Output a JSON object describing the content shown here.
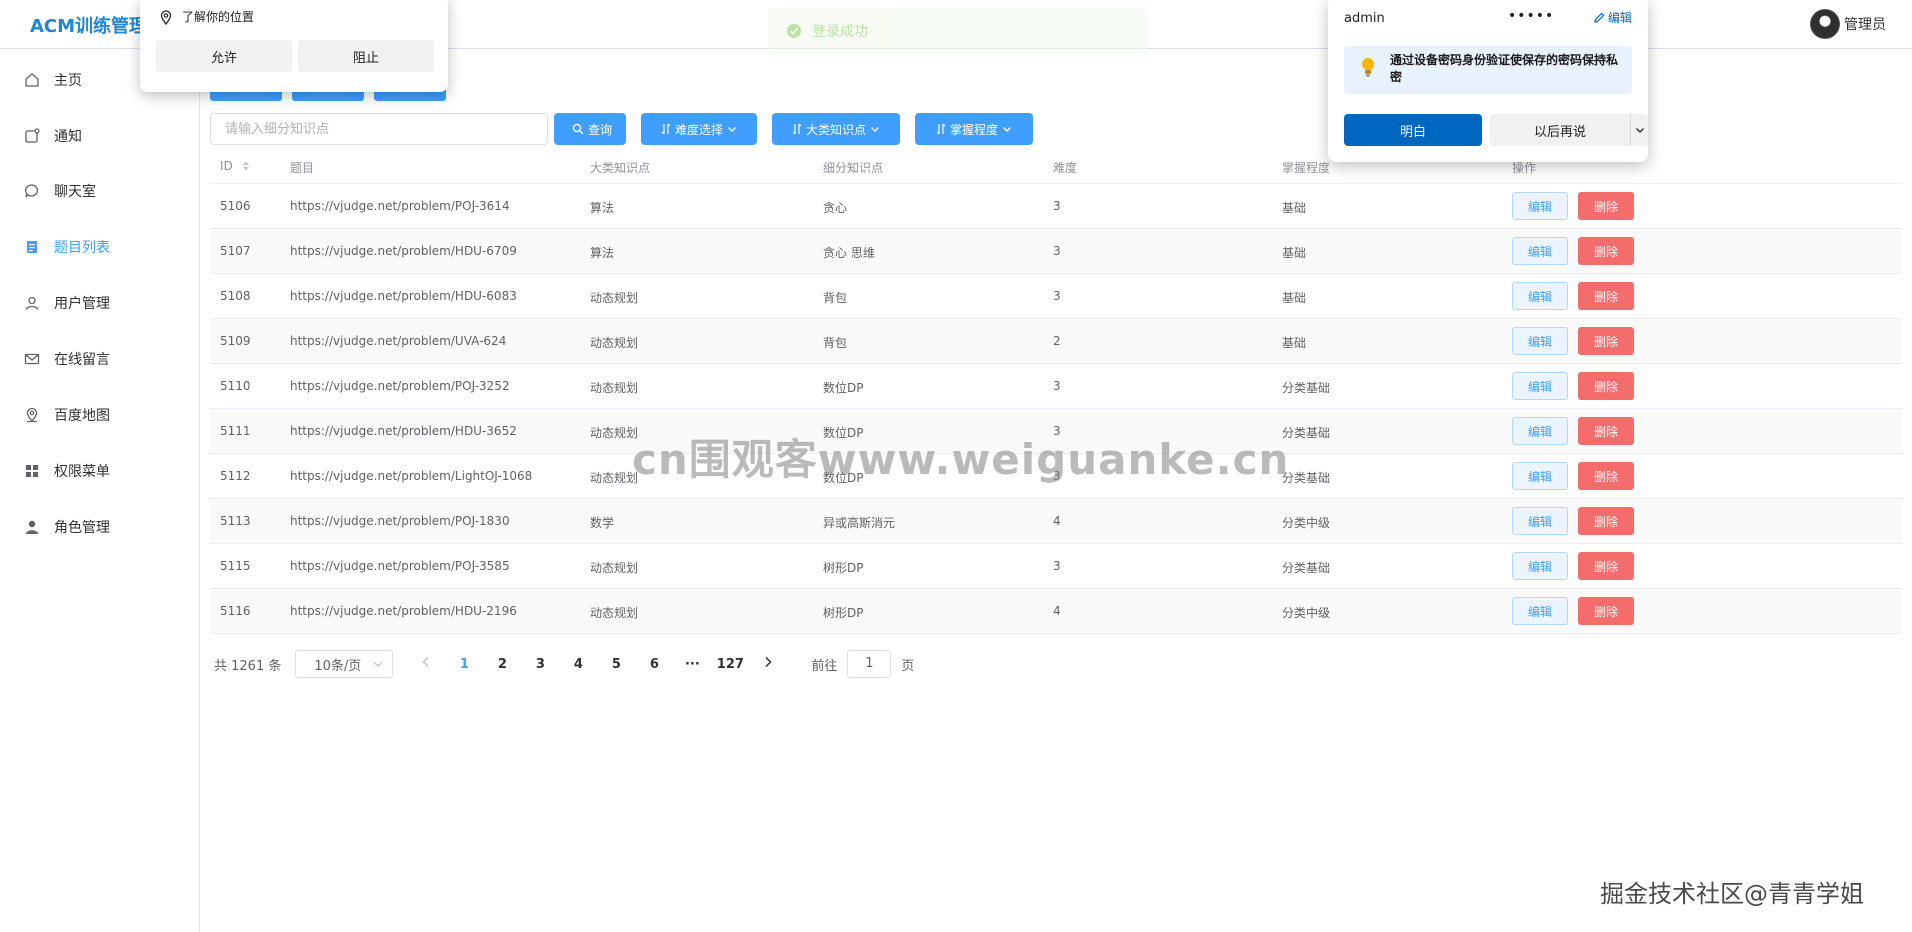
{
  "header": {
    "brand": "ACM训练管理系",
    "user_name": "管理员"
  },
  "sidebar": {
    "items": [
      {
        "label": "主页",
        "icon": "home-icon"
      },
      {
        "label": "通知",
        "icon": "notification-icon"
      },
      {
        "label": "聊天室",
        "icon": "chat-icon"
      },
      {
        "label": "题目列表",
        "icon": "document-icon",
        "active": true
      },
      {
        "label": "用户管理",
        "icon": "user-icon"
      },
      {
        "label": "在线留言",
        "icon": "mail-icon"
      },
      {
        "label": "百度地图",
        "icon": "location-icon"
      },
      {
        "label": "权限菜单",
        "icon": "grid-icon"
      },
      {
        "label": "角色管理",
        "icon": "person-icon"
      }
    ]
  },
  "toolbar": {
    "search_placeholder": "请输入细分知识点",
    "query_label": "查询",
    "difficulty_label": "难度选择",
    "category_label": "大类知识点",
    "mastery_label": "掌握程度"
  },
  "table": {
    "columns": {
      "id": "ID",
      "title": "题目",
      "category": "大类知识点",
      "subcategory": "细分知识点",
      "difficulty": "难度",
      "mastery": "掌握程度",
      "actions": "操作"
    },
    "edit_label": "编辑",
    "delete_label": "删除",
    "rows": [
      {
        "id": "5106",
        "title": "https://vjudge.net/problem/POJ-3614",
        "category": "算法",
        "subcategory": "贪心",
        "difficulty": "3",
        "mastery": "基础"
      },
      {
        "id": "5107",
        "title": "https://vjudge.net/problem/HDU-6709",
        "category": "算法",
        "subcategory": "贪心 思维",
        "difficulty": "3",
        "mastery": "基础"
      },
      {
        "id": "5108",
        "title": "https://vjudge.net/problem/HDU-6083",
        "category": "动态规划",
        "subcategory": "背包",
        "difficulty": "3",
        "mastery": "基础"
      },
      {
        "id": "5109",
        "title": "https://vjudge.net/problem/UVA-624",
        "category": "动态规划",
        "subcategory": "背包",
        "difficulty": "2",
        "mastery": "基础"
      },
      {
        "id": "5110",
        "title": "https://vjudge.net/problem/POJ-3252",
        "category": "动态规划",
        "subcategory": "数位DP",
        "difficulty": "3",
        "mastery": "分类基础"
      },
      {
        "id": "5111",
        "title": "https://vjudge.net/problem/HDU-3652",
        "category": "动态规划",
        "subcategory": "数位DP",
        "difficulty": "3",
        "mastery": "分类基础"
      },
      {
        "id": "5112",
        "title": "https://vjudge.net/problem/LightOJ-1068",
        "category": "动态规划",
        "subcategory": "数位DP",
        "difficulty": "3",
        "mastery": "分类基础"
      },
      {
        "id": "5113",
        "title": "https://vjudge.net/problem/POJ-1830",
        "category": "数学",
        "subcategory": "异或高斯消元",
        "difficulty": "4",
        "mastery": "分类中级"
      },
      {
        "id": "5115",
        "title": "https://vjudge.net/problem/POJ-3585",
        "category": "动态规划",
        "subcategory": "树形DP",
        "difficulty": "3",
        "mastery": "分类基础"
      },
      {
        "id": "5116",
        "title": "https://vjudge.net/problem/HDU-2196",
        "category": "动态规划",
        "subcategory": "树形DP",
        "difficulty": "4",
        "mastery": "分类中级"
      }
    ]
  },
  "pagination": {
    "total": "共 1261 条",
    "page_size": "10条/页",
    "pages": [
      "1",
      "2",
      "3",
      "4",
      "5",
      "6",
      "···",
      "127"
    ],
    "current_page": "1",
    "goto_label": "前往",
    "goto_value": "1",
    "page_unit": "页"
  },
  "location_popup": {
    "title": "了解你的位置",
    "allow_label": "允许",
    "block_label": "阻止"
  },
  "password_popup": {
    "username": "admin",
    "password_mask": "•••••",
    "edit_label": "编辑",
    "note": "通过设备密码身份验证使保存的密码保持私密",
    "ok_label": "明白",
    "later_label": "以后再说"
  },
  "toast": {
    "message": "登录成功"
  },
  "watermarks": {
    "center": "cn围观客www.weiguanke.cn",
    "corner": "掘金技术社区@青青学姐"
  },
  "colors": {
    "primary": "#409eff",
    "danger": "#f56c6c",
    "brand": "#1e86d6",
    "edge_blue": "#0067c0"
  }
}
